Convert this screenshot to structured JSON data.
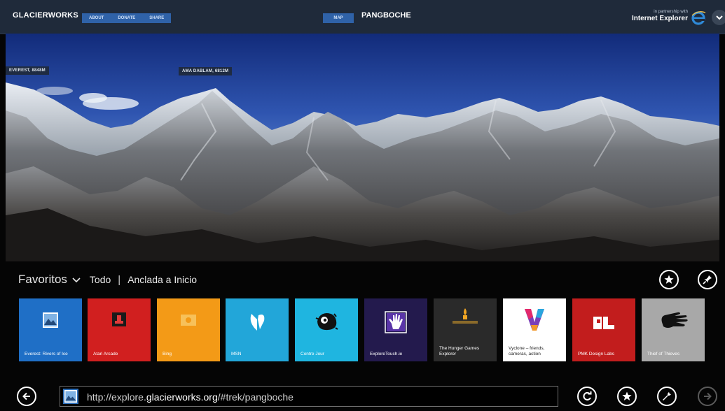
{
  "topbar": {
    "brand": "GLACIERWORKS",
    "nav": [
      "ABOUT",
      "DONATE",
      "SHARE"
    ],
    "map_label": "MAP",
    "place": "PANGBOCHE",
    "partner_small": "in partnership with",
    "partner_name": "Internet Explorer"
  },
  "panorama": {
    "tags": [
      "EVEREST, 8848M",
      "AMA DABLAM, 6812M"
    ]
  },
  "favorites": {
    "title": "Favoritos",
    "option_all": "Todo",
    "separator": "|",
    "option_pinned": "Anclada a Inicio",
    "tiles": [
      {
        "label": "Everest: Rivers of Ice",
        "bg": "#1f6fc6",
        "icon": "landscape-photo-icon"
      },
      {
        "label": "Atari Arcade",
        "bg": "#d11f1f",
        "icon": "arcade-icon"
      },
      {
        "label": "Bing",
        "bg": "#f39a17",
        "icon": "bing-icon"
      },
      {
        "label": "MSN",
        "bg": "#22a6d9",
        "icon": "msn-butterfly-icon"
      },
      {
        "label": "Contre Jour",
        "bg": "#1fb5e0",
        "icon": "contre-jour-creature-icon"
      },
      {
        "label": "ExploreTouch.ie",
        "bg": "#231a4d",
        "icon": "hand-touch-icon"
      },
      {
        "label": "The Hunger Games Explorer",
        "bg": "#2a2a2a",
        "icon": "hunger-games-icon"
      },
      {
        "label": "Vyclone – friends, cameras, action",
        "bg": "#ffffff",
        "icon": "vyclone-icon"
      },
      {
        "label": "PMK Design Labs",
        "bg": "#c21d1d",
        "icon": "pmk-logo-icon"
      },
      {
        "label": "Thief of Thieves",
        "bg": "#a8a8a8",
        "icon": "hand-silhouette-icon"
      }
    ]
  },
  "addressbar": {
    "url_prefix": "http://explore.",
    "url_domain": "glacierworks.org",
    "url_suffix": "/#trek/pangboche"
  }
}
